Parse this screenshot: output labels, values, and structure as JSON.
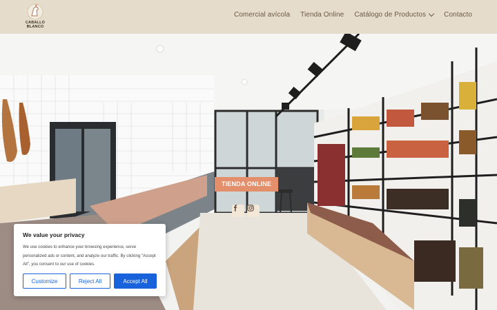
{
  "brand": {
    "name_line1": "CABALLO",
    "name_line2": "BLANCO"
  },
  "nav": {
    "items": [
      {
        "label": "Comercial avícola"
      },
      {
        "label": "Tienda Online"
      },
      {
        "label": "Catálogo de Productos",
        "has_dropdown": true
      },
      {
        "label": "Contacto"
      }
    ]
  },
  "hero": {
    "cta_label": "TIENDA ONLINE",
    "social": [
      "facebook-icon",
      "instagram-icon"
    ]
  },
  "cookie": {
    "title": "We value your privacy",
    "text": "We use cookies to enhance your browsing experience, serve personalized ads or content, and analyze our traffic. By clicking \"Accept All\", you consent to our use of cookies.",
    "customize": "Customize",
    "reject": "Reject All",
    "accept": "Accept All"
  },
  "colors": {
    "header_bg": "#e6dccb",
    "nav_text": "#6a5646",
    "cta_bg": "#e48f6c",
    "cookie_accent": "#1863dc"
  }
}
